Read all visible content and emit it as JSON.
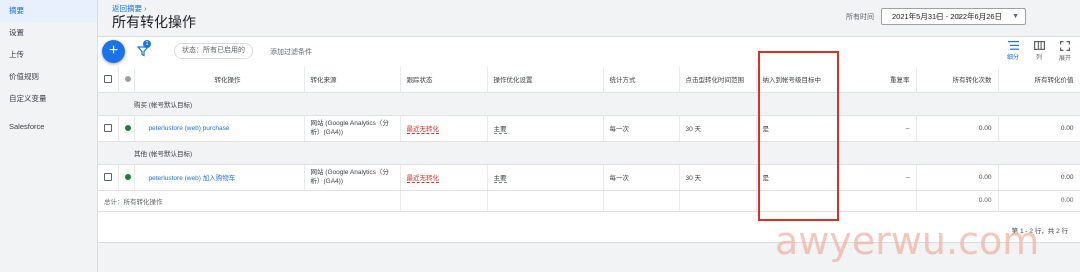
{
  "sidebar": {
    "items": [
      {
        "label": "摘要",
        "active": true
      },
      {
        "label": "设置"
      },
      {
        "label": "上传"
      },
      {
        "label": "价值规则"
      },
      {
        "label": "自定义变量"
      },
      {
        "label": "Salesforce"
      }
    ]
  },
  "header": {
    "back_link": "返回摘要 ›",
    "title": "所有转化操作",
    "date_label": "所有时间",
    "date_range": "2021年5月31日 - 2022年6月26日"
  },
  "toolbar": {
    "filter_count": "1",
    "filter_chip": "状态：所有已启用的",
    "add_filter": "添加过滤条件",
    "segment_label": "细分",
    "columns_label": "列",
    "expand_label": "展开"
  },
  "table": {
    "headers": {
      "action": "转化操作",
      "source": "转化来源",
      "tracking": "跟踪状态",
      "optimization": "操作优化设置",
      "counting": "统计方式",
      "window": "点击型转化时间范围",
      "include": "纳入到帐号级目标中",
      "repeat": "重复率",
      "all_conv": "所有转化次数",
      "all_value": "所有转化价值"
    },
    "groups": [
      {
        "label": "购买 (帐号默认目标)",
        "rows": [
          {
            "action": "peterlustore (web) purchase",
            "source_line1": "网站 (Google Analytics（分",
            "source_line2": "析）(GA4))",
            "tracking": "最近无转化",
            "optimization": "主要",
            "counting": "每一次",
            "window": "30 天",
            "include": "是",
            "repeat": "–",
            "all_conv": "0.00",
            "all_value": "0.00"
          }
        ]
      },
      {
        "label": "其他 (帐号默认目标)",
        "rows": [
          {
            "action": "peterlustore (web) 加入购物车",
            "source_line1": "网站 (Google Analytics（分",
            "source_line2": "析）(GA4))",
            "tracking": "最近无转化",
            "optimization": "主要",
            "counting": "每一次",
            "window": "30 天",
            "include": "是",
            "repeat": "–",
            "all_conv": "0.00",
            "all_value": "0.00"
          }
        ]
      }
    ],
    "total": {
      "label": "总计：所有转化操作",
      "all_conv": "0.00",
      "all_value": "0.00"
    }
  },
  "pagination": "第 1 - 2 行，共 2 行",
  "watermark": "awyerwu.com",
  "colors": {
    "accent": "#1a73e8",
    "warning": "#d93025",
    "status_enabled": "#188038",
    "highlight": "#d93025",
    "watermark": "#f2b3a3"
  }
}
